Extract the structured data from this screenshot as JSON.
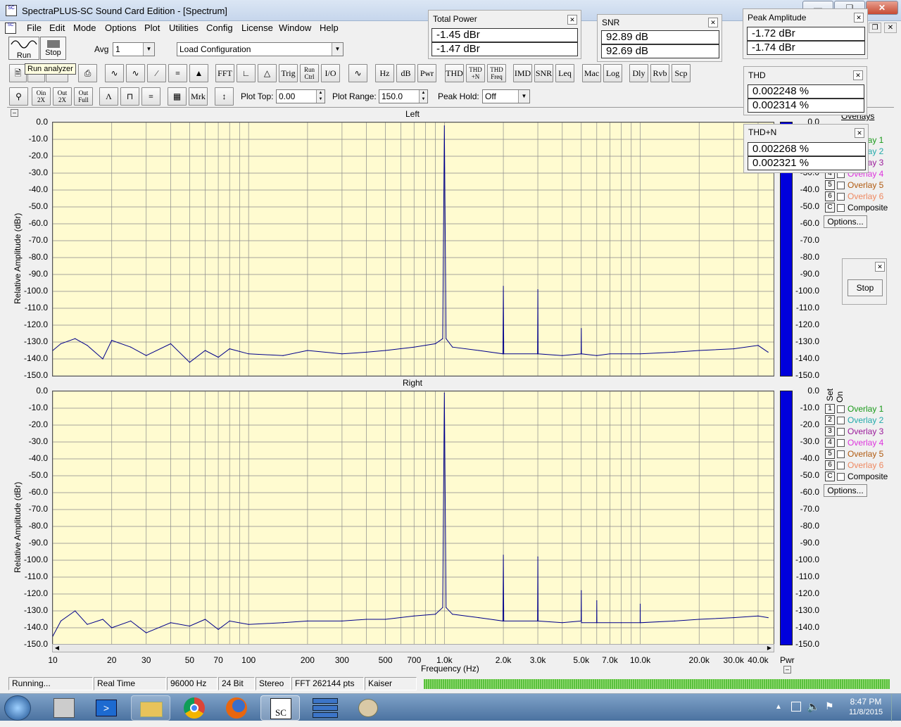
{
  "window": {
    "title": "SpectraPLUS-SC Sound Card Edition - [Spectrum]"
  },
  "menu": [
    "File",
    "Edit",
    "Mode",
    "Options",
    "Plot",
    "Utilities",
    "Config",
    "License",
    "Window",
    "Help"
  ],
  "toolbar": {
    "run_label": "Run",
    "stop_label": "Stop",
    "avg_label": "Avg",
    "avg_value": "1",
    "config_value": "Load Configuration",
    "tooltip": "Run analyzer",
    "buttons_row2": [
      "FFT",
      "Trig",
      "Run Ctrl",
      "I/O",
      "Hz",
      "dB",
      "Pwr",
      "THD",
      "THD +N",
      "THD Freq",
      "IMD",
      "SNR",
      "Leq",
      "Mac",
      "Log",
      "Dly",
      "Rvb",
      "Scp"
    ],
    "zoom_labels": [
      "Oin 2X",
      "Out 2X",
      "Out Full"
    ],
    "mrk_label": "Mrk",
    "plot_top_label": "Plot Top:",
    "plot_top_value": "0.00",
    "plot_range_label": "Plot Range:",
    "plot_range_value": "150.0",
    "peak_hold_label": "Peak Hold:",
    "peak_hold_value": "Off"
  },
  "meters": {
    "total_power": {
      "title": "Total Power",
      "ch1": "-1.45 dBr",
      "ch2": "-1.47 dBr"
    },
    "snr": {
      "title": "SNR",
      "ch1": "92.89 dB",
      "ch2": "92.69 dB"
    },
    "peak_amplitude": {
      "title": "Peak Amplitude",
      "ch1": "-1.72 dBr",
      "ch2": "-1.74 dBr"
    },
    "thd": {
      "title": "THD",
      "ch1": "0.002248 %",
      "ch2": "0.002314 %"
    },
    "thdn": {
      "title": "THD+N",
      "ch1": "0.002268 %",
      "ch2": "0.002321 %"
    }
  },
  "stop_panel": {
    "button": "Stop"
  },
  "plots": {
    "left_title": "Left",
    "right_title": "Right",
    "ylabel": "Relative Amplitude (dBr)",
    "xlabel": "Frequency (Hz)",
    "bar_label": "Pwr",
    "y_ticks": [
      "0.0",
      "-10.0",
      "-20.0",
      "-30.0",
      "-40.0",
      "-50.0",
      "-60.0",
      "-70.0",
      "-80.0",
      "-90.0",
      "-100.0",
      "-110.0",
      "-120.0",
      "-130.0",
      "-140.0",
      "-150.0"
    ],
    "x_ticks": [
      "10",
      "20",
      "30",
      "50",
      "70",
      "100",
      "200",
      "300",
      "500",
      "700",
      "1.0k",
      "2.0k",
      "3.0k",
      "5.0k",
      "7.0k",
      "10.0k",
      "20.0k",
      "30.0k",
      "40.0k"
    ]
  },
  "overlays": {
    "header": "Overlays",
    "set_label": "Set",
    "on_label": "On",
    "items": [
      {
        "num": "1",
        "label": "Overlay 1",
        "color": "#1a9a1a"
      },
      {
        "num": "2",
        "label": "Overlay 2",
        "color": "#22aaaa"
      },
      {
        "num": "3",
        "label": "Overlay 3",
        "color": "#9a1a9a"
      },
      {
        "num": "4",
        "label": "Overlay 4",
        "color": "#dd33dd"
      },
      {
        "num": "5",
        "label": "Overlay 5",
        "color": "#b05a10"
      },
      {
        "num": "6",
        "label": "Overlay 6",
        "color": "#ee8860"
      },
      {
        "num": "C",
        "label": "Composite",
        "color": "#000000"
      }
    ],
    "options_label": "Options..."
  },
  "chart_data": [
    {
      "type": "line",
      "title": "Left",
      "xlabel": "Frequency (Hz)",
      "ylabel": "Relative Amplitude (dBr)",
      "x_scale": "log",
      "xlim": [
        10,
        48000
      ],
      "ylim": [
        -150,
        0
      ],
      "grid": true,
      "series": [
        {
          "color": "#00008b",
          "x": [
            10,
            11,
            13,
            15,
            18,
            20,
            25,
            30,
            40,
            50,
            60,
            70,
            80,
            100,
            150,
            200,
            300,
            400,
            500,
            700,
            900,
            980,
            1000,
            1020,
            1100,
            1500,
            1990,
            2000,
            2010,
            2990,
            3000,
            3010,
            4000,
            4990,
            5000,
            5010,
            6000,
            7000,
            8000,
            10000,
            15000,
            20000,
            30000,
            40000,
            45000
          ],
          "y": [
            -135,
            -131,
            -128,
            -132,
            -140,
            -129,
            -133,
            -138,
            -131,
            -142,
            -135,
            -139,
            -134,
            -137,
            -138,
            -135,
            -137,
            -136,
            -135,
            -133,
            -131,
            -128,
            -2,
            -128,
            -133,
            -135,
            -137,
            -97,
            -137,
            -137,
            -99,
            -137,
            -138,
            -137,
            -122,
            -137,
            -138,
            -137,
            -137,
            -137,
            -136,
            -135,
            -134,
            -132,
            -136
          ]
        }
      ]
    },
    {
      "type": "line",
      "title": "Right",
      "xlabel": "Frequency (Hz)",
      "ylabel": "Relative Amplitude (dBr)",
      "x_scale": "log",
      "xlim": [
        10,
        48000
      ],
      "ylim": [
        -150,
        0
      ],
      "grid": true,
      "series": [
        {
          "color": "#00008b",
          "x": [
            10,
            11,
            13,
            15,
            18,
            20,
            25,
            30,
            40,
            50,
            60,
            70,
            80,
            100,
            150,
            200,
            300,
            400,
            500,
            700,
            900,
            980,
            1000,
            1020,
            1100,
            1500,
            1990,
            2000,
            2010,
            2990,
            3000,
            3010,
            4000,
            4990,
            5000,
            5010,
            5990,
            6000,
            6010,
            8000,
            9990,
            10000,
            10010,
            15000,
            20000,
            30000,
            40000,
            45000
          ],
          "y": [
            -145,
            -136,
            -130,
            -138,
            -135,
            -140,
            -136,
            -143,
            -137,
            -139,
            -135,
            -141,
            -136,
            -138,
            -137,
            -136,
            -136,
            -135,
            -135,
            -133,
            -132,
            -128,
            -1,
            -128,
            -132,
            -134,
            -136,
            -97,
            -136,
            -136,
            -98,
            -136,
            -137,
            -136,
            -118,
            -137,
            -137,
            -124,
            -137,
            -137,
            -137,
            -126,
            -137,
            -136,
            -135,
            -134,
            -133,
            -134
          ]
        }
      ]
    }
  ],
  "status": {
    "state": "Running...",
    "mode": "Real Time",
    "rate": "96000 Hz",
    "bits": "24 Bit",
    "channels": "Stereo",
    "fft": "FFT 262144 pts",
    "window": "Kaiser"
  },
  "taskbar": {
    "time": "8:47 PM",
    "date": "11/8/2015"
  }
}
